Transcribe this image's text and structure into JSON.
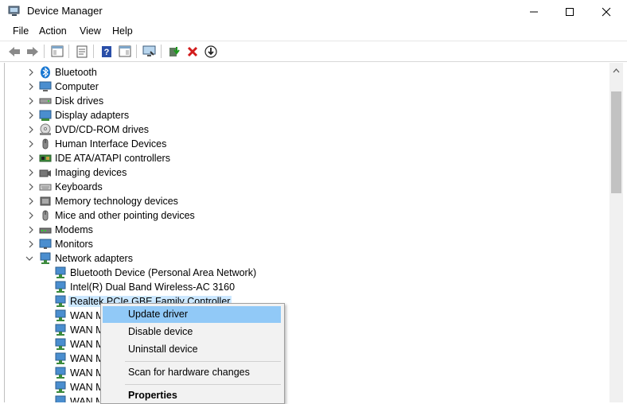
{
  "window": {
    "title": "Device Manager"
  },
  "menubar": {
    "items": [
      "File",
      "Action",
      "View",
      "Help"
    ]
  },
  "toolbar": {
    "buttons": [
      "back-icon",
      "forward-icon",
      "show-hide-tree-icon",
      "properties-icon",
      "help-icon",
      "action-pane-icon",
      "scan-hardware-icon",
      "update-driver-icon",
      "uninstall-icon",
      "download-icon"
    ]
  },
  "tree": {
    "categories": [
      {
        "label": "Bluetooth",
        "icon": "bluetooth-icon"
      },
      {
        "label": "Computer",
        "icon": "computer-icon"
      },
      {
        "label": "Disk drives",
        "icon": "disk-drive-icon"
      },
      {
        "label": "Display adapters",
        "icon": "display-adapter-icon"
      },
      {
        "label": "DVD/CD-ROM drives",
        "icon": "dvd-drive-icon"
      },
      {
        "label": "Human Interface Devices",
        "icon": "hid-icon"
      },
      {
        "label": "IDE ATA/ATAPI controllers",
        "icon": "ide-controller-icon"
      },
      {
        "label": "Imaging devices",
        "icon": "camera-icon"
      },
      {
        "label": "Keyboards",
        "icon": "keyboard-icon"
      },
      {
        "label": "Memory technology devices",
        "icon": "memory-icon"
      },
      {
        "label": "Mice and other pointing devices",
        "icon": "mouse-icon"
      },
      {
        "label": "Modems",
        "icon": "modem-icon"
      },
      {
        "label": "Monitors",
        "icon": "monitor-icon"
      },
      {
        "label": "Network adapters",
        "icon": "network-adapter-icon"
      }
    ],
    "network_children": [
      "Bluetooth Device (Personal Area Network)",
      "Intel(R) Dual Band Wireless-AC 3160",
      "Realtek PCIe GBE Family Controller",
      "WAN M",
      "WAN M",
      "WAN M",
      "WAN M",
      "WAN M",
      "WAN M",
      "WAN M"
    ]
  },
  "context_menu": {
    "update": "Update driver",
    "disable": "Disable device",
    "uninstall": "Uninstall device",
    "scan": "Scan for hardware changes",
    "properties": "Properties"
  }
}
